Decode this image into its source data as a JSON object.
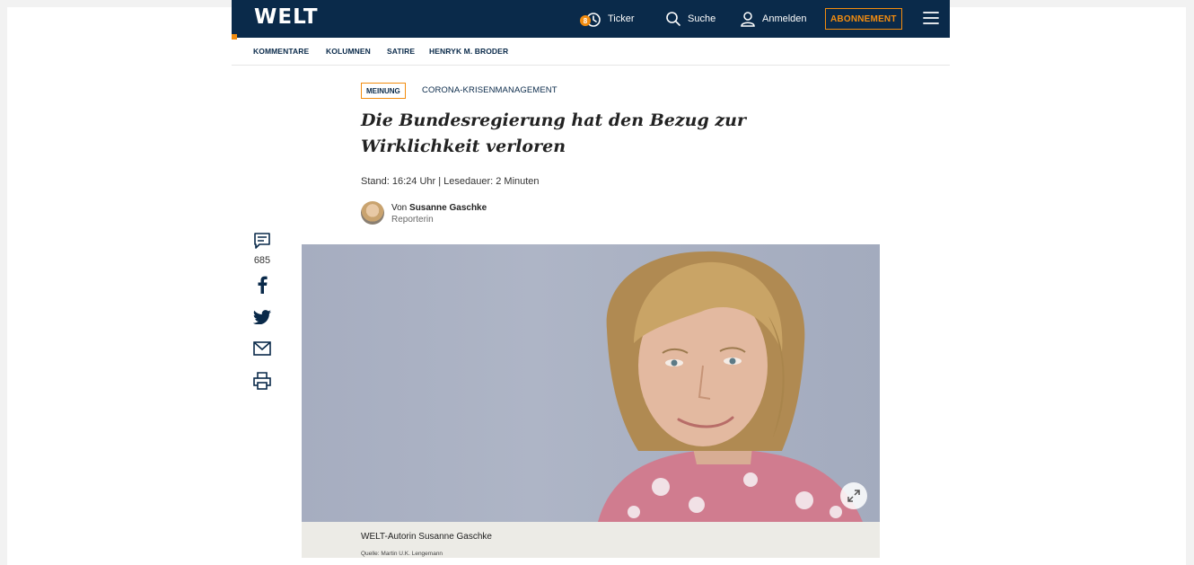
{
  "header": {
    "logo": "WELT",
    "ticker_badge": "8",
    "ticker_label": "Ticker",
    "search_label": "Suche",
    "login_label": "Anmelden",
    "subscribe_label": "ABONNEMENT",
    "icons": [
      "clock-icon",
      "search-icon",
      "user-icon",
      "menu-icon"
    ],
    "colors": {
      "navy": "#0a2a4a",
      "orange": "#f28c0f"
    }
  },
  "subnav": {
    "items": [
      "KOMMENTARE",
      "KOLUMNEN",
      "SATIRE",
      "HENRYK M. BRODER"
    ]
  },
  "article": {
    "kicker": "MEINUNG",
    "topic": "CORONA-KRISENMANAGEMENT",
    "headline": "Die Bundesregierung hat den Bezug zur Wirklichkeit verloren",
    "meta": "Stand: 16:24 Uhr | Lesedauer: 2 Minuten",
    "author_prefix": "Von",
    "author_name": "Susanne Gaschke",
    "author_role": "Reporterin"
  },
  "share": {
    "comment_count": "685",
    "icons": [
      "comment-icon",
      "facebook-icon",
      "twitter-icon",
      "mail-icon",
      "print-icon"
    ]
  },
  "image": {
    "caption": "WELT-Autorin Susanne Gaschke",
    "credit": "Quelle: Martin U.K. Lengemann"
  }
}
